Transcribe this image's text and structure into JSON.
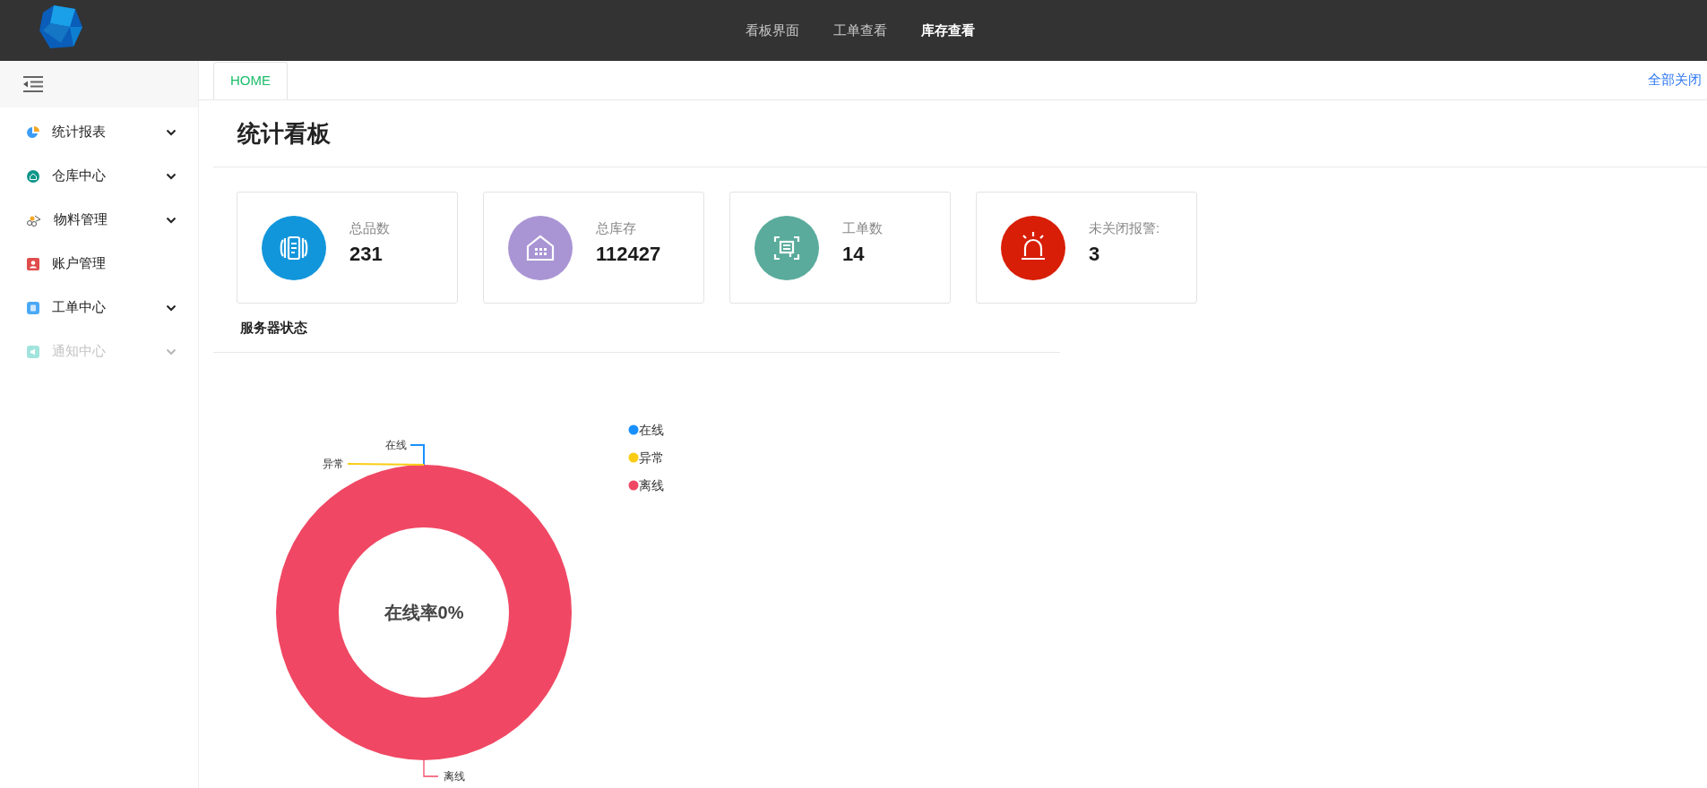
{
  "top_nav": [
    {
      "label": "看板界面",
      "selected": false
    },
    {
      "label": "工单查看",
      "selected": false
    },
    {
      "label": "库存查看",
      "selected": true
    }
  ],
  "sidebar": {
    "items": [
      {
        "label": "统计报表",
        "kind": "chart",
        "expandable": true,
        "disabled": false
      },
      {
        "label": "仓库中心",
        "kind": "warehouse",
        "expandable": true,
        "disabled": false
      },
      {
        "label": "物料管理",
        "kind": "material",
        "expandable": true,
        "disabled": false
      },
      {
        "label": "账户管理",
        "kind": "account",
        "expandable": false,
        "disabled": false
      },
      {
        "label": "工单中心",
        "kind": "order",
        "expandable": true,
        "disabled": false
      },
      {
        "label": "通知中心",
        "kind": "notice",
        "expandable": true,
        "disabled": true
      }
    ]
  },
  "tabs": [
    {
      "label": "HOME",
      "selected": true
    }
  ],
  "close_all": "全部关闭",
  "page_title": "统计看板",
  "stat_cards": [
    {
      "label": "总品数",
      "value": "231",
      "kind": "items",
      "color": "#1296db"
    },
    {
      "label": "总库存",
      "value": "112427",
      "kind": "stock",
      "color": "#a995d4"
    },
    {
      "label": "工单数",
      "value": "14",
      "kind": "orders",
      "color": "#5aab9c"
    },
    {
      "label": "未关闭报警:",
      "value": "3",
      "kind": "alarm",
      "color": "#d81e06"
    }
  ],
  "server_status": {
    "title": "服务器状态",
    "center_text": "在线率0%",
    "slices": [
      {
        "name": "在线",
        "color": "#1890ff",
        "kind": "empty"
      },
      {
        "name": "异常",
        "color": "#facc14",
        "kind": "empty"
      },
      {
        "name": "离线",
        "color": "#f04864",
        "kind": "full"
      }
    ],
    "legend": [
      {
        "label": "在线",
        "color": "#1890ff"
      },
      {
        "label": "异常",
        "color": "#facc14"
      },
      {
        "label": "离线",
        "color": "#f04864"
      }
    ]
  }
}
